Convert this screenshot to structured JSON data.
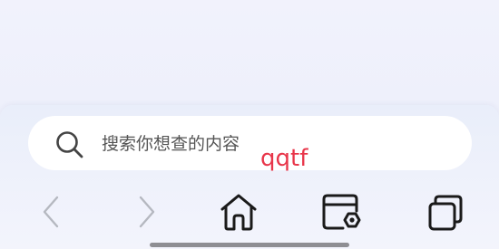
{
  "search": {
    "placeholder": "搜索你想查的内容"
  },
  "overlay": {
    "text": "qqtf",
    "color": "#e8364a"
  },
  "toolbar": {
    "back_icon": "chevron-left-icon",
    "forward_icon": "chevron-right-icon",
    "home_icon": "home-icon",
    "tasks_icon": "calendar-settings-icon",
    "tabs_icon": "tabs-icon"
  },
  "colors": {
    "background": "#eef0fb",
    "search_bar": "#ffffff",
    "icon_dark": "#1a1a1a",
    "icon_disabled": "#b5b8c0"
  }
}
